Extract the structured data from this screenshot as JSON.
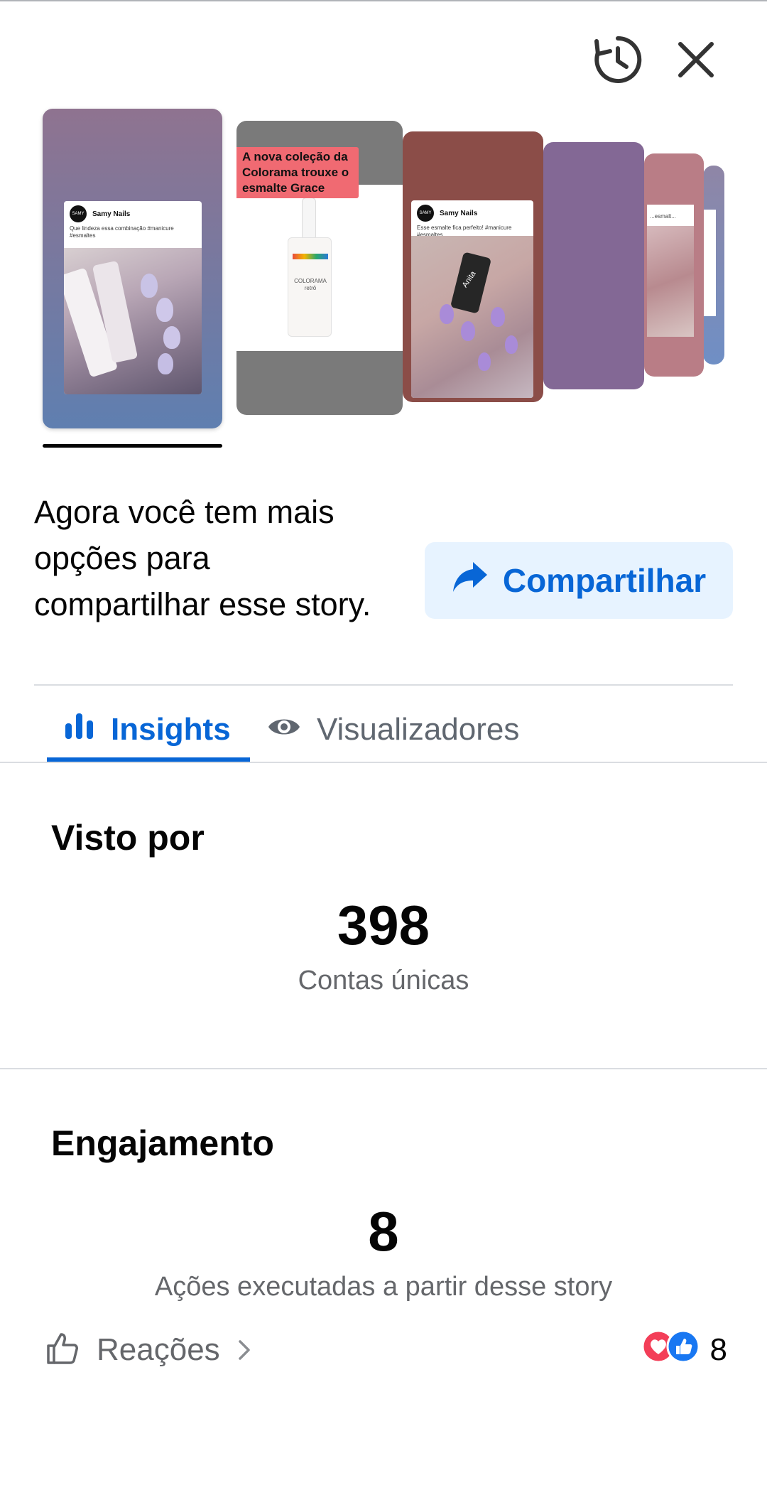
{
  "header": {
    "history_icon": "history-icon",
    "close_icon": "close-icon"
  },
  "story_strip": {
    "cards": [
      {
        "author": "Samy Nails",
        "caption": "Que lindeza essa combinação #manicure #esmaltes",
        "avatar_text": "SAMY"
      },
      {
        "overlay_text_lines": [
          "A nova coleção da",
          "Colorama trouxe o",
          "esmalte Grace"
        ],
        "bottle_label": "COLORAMA retrô"
      },
      {
        "author": "Samy Nails",
        "caption": "Esse esmalte fica perfeito! #manicure #esmaltes",
        "avatar_text": "SAMY",
        "bottle_label": "Anita"
      },
      {},
      {
        "caption": "...esmalt..."
      },
      {}
    ]
  },
  "share": {
    "text": "Agora você tem mais opções para compartilhar esse story.",
    "button_label": "Compartilhar"
  },
  "tabs": {
    "insights_label": "Insights",
    "viewers_label": "Visualizadores"
  },
  "seen_by": {
    "title": "Visto por",
    "value": "398",
    "subtitle": "Contas únicas"
  },
  "engagement": {
    "title": "Engajamento",
    "value": "8",
    "subtitle": "Ações executadas a partir desse story",
    "reactions_label": "Reações",
    "reactions_count": "8"
  },
  "colors": {
    "accent": "#0866d6",
    "share_bg": "#e7f3ff",
    "muted_text": "#65676b",
    "divider": "#dadde1"
  }
}
